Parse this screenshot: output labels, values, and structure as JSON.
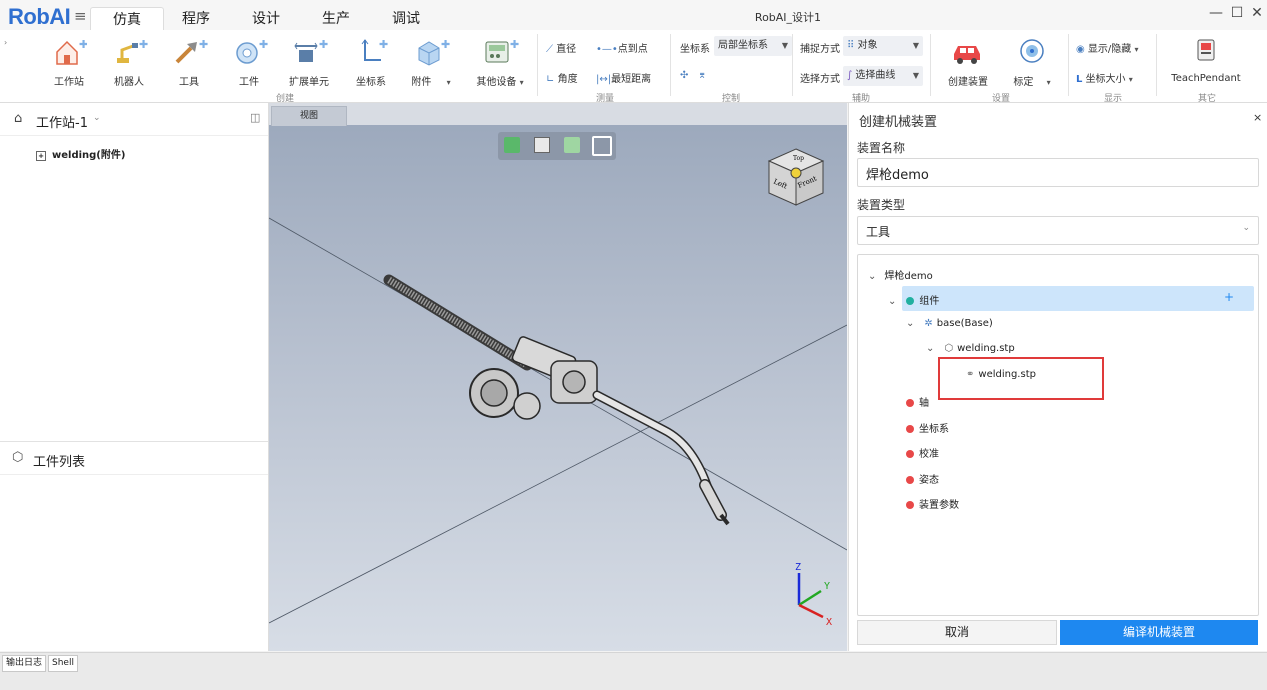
{
  "app": {
    "logo": "RobAI",
    "window_title": "RobAI_设计1"
  },
  "tabs": [
    "仿真",
    "程序",
    "设计",
    "生产",
    "调试"
  ],
  "ribbon": {
    "create": {
      "items": [
        "工作站",
        "机器人",
        "工具",
        "工件",
        "扩展单元",
        "坐标系",
        "附件",
        "其他设备"
      ],
      "label": "创建"
    },
    "measure": {
      "diameter": "直径",
      "point_to_point": "点到点",
      "angle": "角度",
      "shortest_distance": "最短距离",
      "label": "测量"
    },
    "control": {
      "coord_label": "坐标系",
      "coord_value": "局部坐标系",
      "label": "控制"
    },
    "assist": {
      "snap_label": "捕捉方式",
      "snap_value": "对象",
      "select_label": "选择方式",
      "select_value": "选择曲线",
      "label": "辅助"
    },
    "settings": {
      "create_device": "创建装置",
      "calibrate": "标定",
      "label": "设置"
    },
    "display": {
      "show_hide": "显示/隐藏",
      "axis_size": "坐标大小",
      "label": "显示"
    },
    "other": {
      "teach_pendant": "TeachPendant",
      "label": "其它"
    }
  },
  "left_panel": {
    "station_title": "工作站-1",
    "tree_item": "welding(附件)",
    "workpiece_title": "工件列表"
  },
  "viewport": {
    "tab": "视图",
    "navcube": {
      "top": "Top",
      "left": "Left",
      "front": "Front"
    },
    "axes": {
      "x": "X",
      "y": "Y",
      "z": "Z"
    }
  },
  "right_panel": {
    "title": "创建机械装置",
    "name_label": "装置名称",
    "name_value": "焊枪demo",
    "type_label": "装置类型",
    "type_value": "工具",
    "tree": {
      "root": "焊枪demo",
      "components": "组件",
      "base": "base(Base)",
      "file": "welding.stp",
      "file_child": "welding.stp",
      "axis": "轴",
      "coord": "坐标系",
      "calibration": "校准",
      "pose": "姿态",
      "params": "装置参数"
    },
    "cancel_button": "取消",
    "compile_button": "编译机械装置"
  },
  "bottom_tabs": [
    "输出日志",
    "Shell"
  ],
  "colors": {
    "accent": "#1e88f0",
    "logo": "#2f6fd0",
    "highlight_border": "#e03a3a",
    "selected_row": "#cde5fb",
    "ok_dot": "#21b0a0",
    "error_dot": "#e84848"
  }
}
